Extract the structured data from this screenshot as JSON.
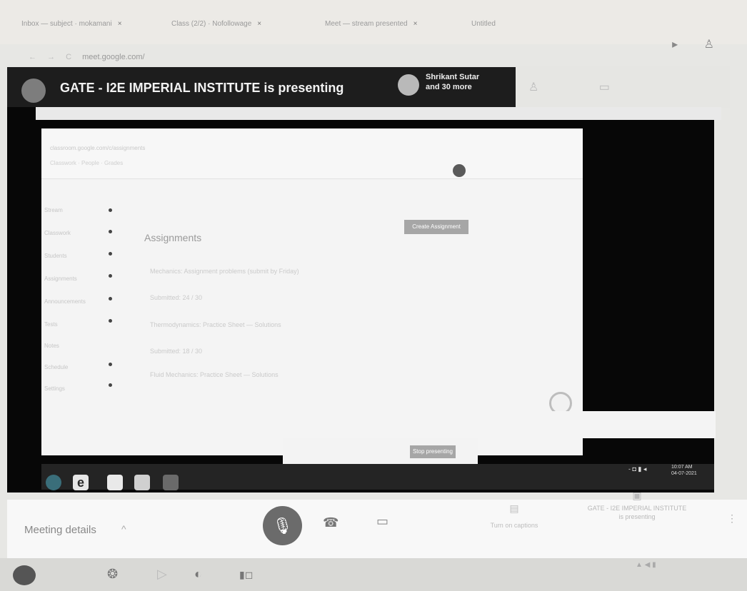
{
  "browser": {
    "tabs": [
      {
        "title": "Inbox — subject · mokamani",
        "close": "×"
      },
      {
        "title": "Class (2/2) · Nofollowage",
        "close": "×"
      },
      {
        "title": "Meet — stream presented",
        "close": "×"
      },
      {
        "title": "Untitled",
        "close": ""
      }
    ],
    "address_url": "meet.google.com/",
    "nav_back": "←",
    "nav_forward": "→",
    "nav_reload": "C"
  },
  "meet": {
    "presenting_title": "GATE - I2E IMPERIAL INSTITUTE is presenting",
    "participants_line1": "Shrikant Sutar",
    "participants_line2": "and 30 more",
    "meeting_details_label": "Meeting details",
    "meeting_details_chevron": "^",
    "mic_icon": "🎙",
    "hangup_icon": "☎",
    "camera_icon": "▭",
    "captions_label": "Turn on captions",
    "captions_icon": "▤",
    "presenting_label_line1": "GATE - I2E IMPERIAL INSTITUTE",
    "presenting_label_line2": "is presenting",
    "presenting_icon": "▣",
    "more_icon": "⋮"
  },
  "shared_screen": {
    "doc_url": "classroom.google.com/c/assignments",
    "doc_sub": "Classwork · People · Grades",
    "assignments_heading": "Assignments",
    "create_button": "Create Assignment",
    "sidebar_items": [
      "Stream",
      "Classwork",
      "Students",
      "Assignments",
      "Announcements",
      "Tests",
      "Notes",
      "Schedule",
      "Settings"
    ],
    "rows": [
      "Mechanics: Assignment problems (submit by Friday)",
      "Submitted: 24 / 30",
      "Thermodynamics: Practice Sheet — Solutions",
      "Submitted: 18 / 30",
      "Fluid Mechanics: Practice Sheet — Solutions"
    ],
    "stop_presenting": "Stop presenting",
    "inner_tray_icons": "- ◘ ▮ ◂",
    "inner_clock_line1": "10:07 AM",
    "inner_clock_line2": "04-07-2021"
  },
  "os": {
    "tray_text": "▲ ◀ ▮"
  }
}
